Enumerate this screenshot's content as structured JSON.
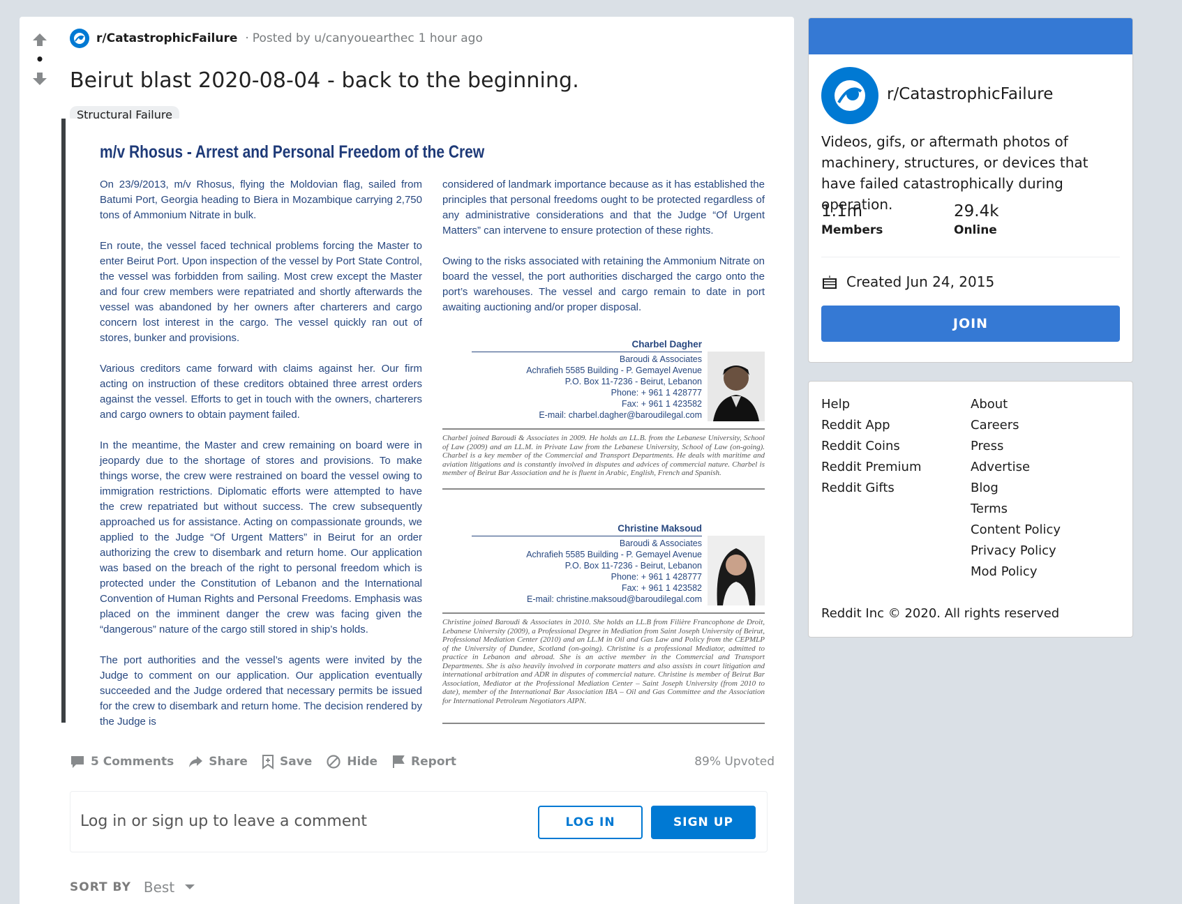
{
  "post": {
    "subreddit": "r/CatastrophicFailure",
    "separator": "·",
    "posted_by": "Posted by u/canyouearthec",
    "time": "1 hour ago",
    "title": "Beirut blast 2020-08-04 - back to the beginning.",
    "flair": "Structural Failure"
  },
  "document": {
    "title": "m/v Rhosus - Arrest and Personal Freedom of the Crew",
    "left_paragraphs": [
      "On 23/9/2013, m/v Rhosus, flying the Moldovian flag, sailed from Batumi Port, Georgia heading to Biera in Mozambique carrying 2,750 tons of Ammonium Nitrate in bulk.",
      "En route, the vessel faced technical problems forcing the Master to enter Beirut Port. Upon inspection of the vessel by Port State Control, the vessel was forbidden from sailing. Most crew except the Master and four crew members were repatriated and shortly afterwards the vessel was abandoned by her owners after charterers and cargo concern lost interest in the cargo. The vessel quickly ran out of stores, bunker and provisions.",
      "Various creditors came forward with claims against her. Our firm acting on instruction of these creditors obtained three arrest orders against the vessel. Efforts to get in touch with the owners, charterers and cargo owners to obtain payment failed.",
      "In the meantime, the Master and crew remaining on board were in jeopardy due to the shortage of stores and provisions. To make things worse, the crew were restrained on board the vessel owing to immigration restrictions. Diplomatic efforts were attempted to have the crew repatriated but without success. The crew subsequently approached us for assistance. Acting on compassionate grounds, we applied to the Judge “Of Urgent Matters” in Beirut for an order authorizing the crew to disembark and return home. Our application was based on the breach of the right to personal freedom which is protected under the Constitution of Lebanon and the International Convention of Human Rights and Personal Freedoms. Emphasis was placed on the imminent danger the crew was facing given the “dangerous” nature of the cargo still stored in ship’s holds.",
      "The port authorities and the vessel’s agents were invited by the Judge to comment on our application. Our application eventually succeeded and the Judge ordered that necessary permits be issued for the crew to disembark and return home. The decision rendered by the Judge is"
    ],
    "right_paragraphs": [
      "considered of landmark importance because as it has established the principles that personal freedoms ought to be protected regardless of any administrative considerations and that the Judge “Of Urgent Matters” can intervene to ensure protection of these rights.",
      "Owing to the risks associated with retaining the Ammonium Nitrate on board the vessel, the port authorities discharged the cargo onto the port’s warehouses. The vessel and cargo remain to date in port awaiting auctioning and/or proper disposal."
    ],
    "contacts": [
      {
        "name": "Charbel Dagher",
        "firm": "Baroudi & Associates",
        "address": "Achrafieh 5585 Building - P. Gemayel Avenue",
        "pobox": "P.O. Box 11-7236 - Beirut, Lebanon",
        "phone": "Phone: + 961 1 428777",
        "fax": "Fax: + 961 1 423582",
        "email": "E-mail: charbel.dagher@baroudilegal.com",
        "bio": "Charbel joined Baroudi & Associates in 2009. He holds an LL.B. from the Lebanese University, School of Law (2009) and an LL.M. in Private Law from the Lebanese University, School of Law (on-going). Charbel is a key member of the Commercial and Transport Departments. He deals with maritime and aviation litigations and is constantly involved in disputes and advices of commercial nature. Charbel is member of Beirut Bar Association and he is fluent in Arabic, English, French and Spanish."
      },
      {
        "name": "Christine Maksoud",
        "firm": "Baroudi & Associates",
        "address": "Achrafieh 5585 Building - P. Gemayel Avenue",
        "pobox": "P.O. Box 11-7236 - Beirut, Lebanon",
        "phone": "Phone: + 961 1 428777",
        "fax": "Fax: + 961 1 423582",
        "email": "E-mail: christine.maksoud@baroudilegal.com",
        "bio": "Christine joined Baroudi & Associates in 2010. She holds an LL.B from Filière Francophone de Droit, Lebanese University (2009), a Professional Degree in Mediation from Saint Joseph University of Beirut, Professional Mediation Center (2010) and an LL.M in Oil and Gas Law and Policy from the CEPMLP of the University of Dundee, Scotland (on-going). Christine is a professional Mediator, admitted to practice in Lebanon and abroad. She is an active member in the Commercial and Transport Departments. She is also heavily involved in corporate matters and also assists in court litigation and international arbitration and ADR in disputes of commercial nature. Christine is member of Beirut Bar Association, Mediator at the Professional Mediation Center – Saint Joseph University (from 2010 to date), member of the International Bar Association IBA – Oil and Gas Committee and the Association for International Petroleum Negotiators AIPN."
      }
    ]
  },
  "actions": {
    "comments": "5 Comments",
    "share": "Share",
    "save": "Save",
    "hide": "Hide",
    "report": "Report",
    "upvoted": "89% Upvoted"
  },
  "comment": {
    "prompt": "Log in or sign up to leave a comment",
    "login": "LOG IN",
    "signup": "SIGN UP"
  },
  "sort": {
    "label": "SORT BY",
    "value": "Best"
  },
  "sidebar": {
    "name": "r/CatastrophicFailure",
    "description": "Videos, gifs, or aftermath photos of machinery, structures, or devices that have failed catastrophically during operation.",
    "members_count": "1.1m",
    "members_label": "Members",
    "online_count": "29.4k",
    "online_label": "Online",
    "created": "Created Jun 24, 2015",
    "join": "JOIN"
  },
  "footer": {
    "left_links": [
      "Help",
      "Reddit App",
      "Reddit Coins",
      "Reddit Premium",
      "Reddit Gifts"
    ],
    "right_links": [
      "About",
      "Careers",
      "Press",
      "Advertise",
      "Blog",
      "Terms",
      "Content Policy",
      "Privacy Policy",
      "Mod Policy"
    ],
    "copyright": "Reddit Inc © 2020. All rights reserved"
  },
  "colors": {
    "accent": "#0079d3",
    "join_blue": "#3579d4",
    "doc_heading": "#1e3a78",
    "doc_text": "#27477f",
    "page_bg": "#dae0e6"
  },
  "icons": {
    "upvote": "up-arrow-icon",
    "downvote": "down-arrow-icon",
    "comments": "comment-bubble-icon",
    "share": "share-arrow-icon",
    "save": "bookmark-plus-icon",
    "hide": "circle-slash-icon",
    "report": "flag-icon",
    "cake": "cake-icon",
    "sort": "caret-down-icon"
  }
}
